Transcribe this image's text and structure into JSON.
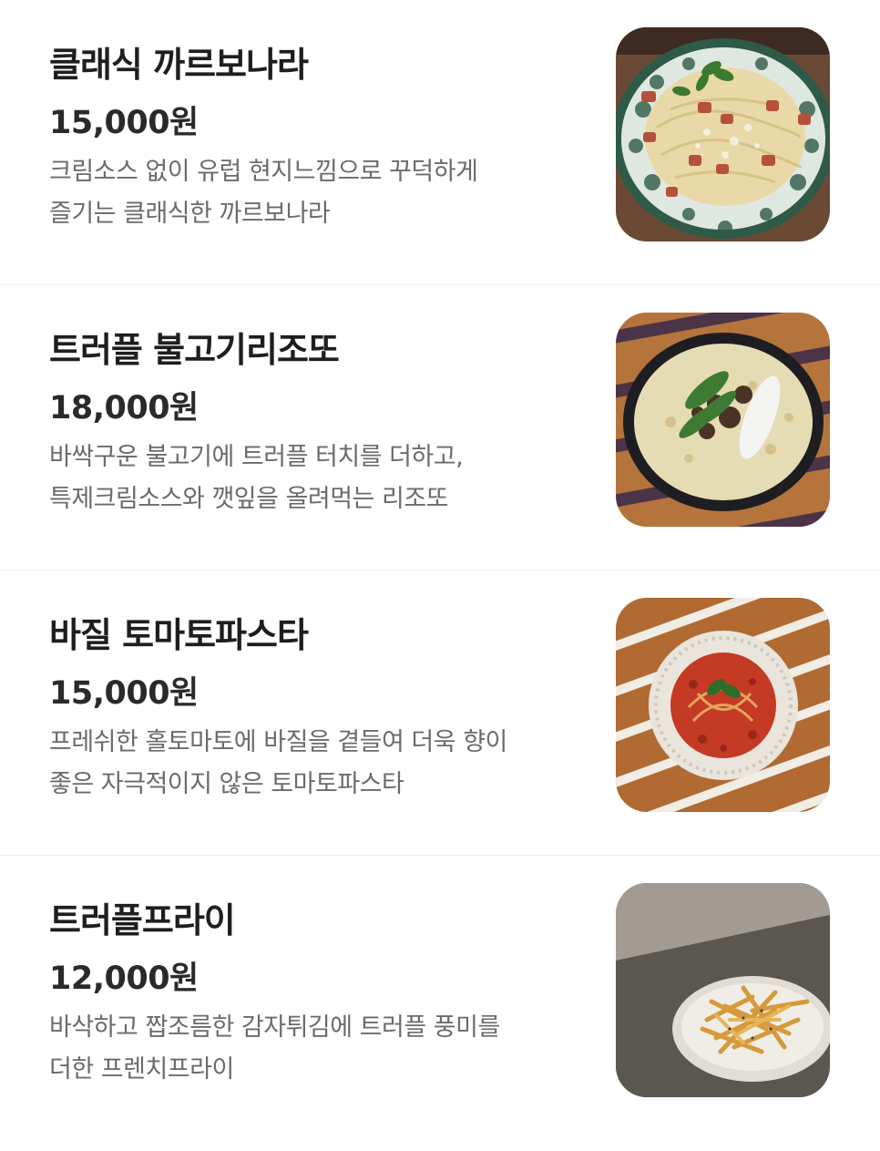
{
  "menu": {
    "items": [
      {
        "name": "클래식 까르보나라",
        "price": "15,000원",
        "desc_line1": "크림소스 없이 유럽 현지느낌으로 꾸덕하게",
        "desc_line2": "즐기는 클래식한 까르보나라",
        "image_icon": "carbonara-photo"
      },
      {
        "name": "트러플 불고기리조또",
        "price": "18,000원",
        "desc_line1": "바싹구운 불고기에 트러플 터치를 더하고,",
        "desc_line2": "특제크림소스와 깻잎을 올려먹는 리조또",
        "image_icon": "risotto-photo"
      },
      {
        "name": "바질 토마토파스타",
        "price": "15,000원",
        "desc_line1": "프레쉬한 홀토마토에 바질을 곁들여 더욱 향이",
        "desc_line2": "좋은 자극적이지 않은 토마토파스타",
        "image_icon": "tomato-pasta-photo"
      },
      {
        "name": "트러플프라이",
        "price": "12,000원",
        "desc_line1": "바삭하고 짭조름한 감자튀김에 트러플 풍미를",
        "desc_line2": "더한 프렌치프라이",
        "image_icon": "fries-photo"
      }
    ]
  },
  "colors": {
    "title": "#1e1e1e",
    "price": "#2a2a2a",
    "description": "#6b6b6b",
    "divider": "#eeeeee",
    "background": "#ffffff"
  }
}
